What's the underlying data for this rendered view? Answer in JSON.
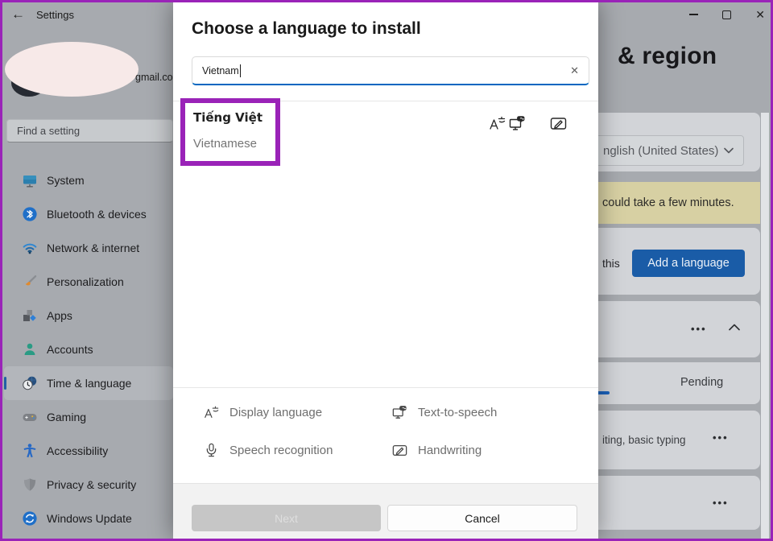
{
  "titlebar": {
    "app_title": "Settings"
  },
  "icons": {
    "back": "←",
    "close": "✕",
    "search_clear": "✕",
    "more": "•••"
  },
  "sidebar": {
    "email_fragment": "gmail.co",
    "search_placeholder": "Find a setting",
    "items": [
      {
        "label": "System",
        "icon": "system-monitor-icon"
      },
      {
        "label": "Bluetooth & devices",
        "icon": "bluetooth-icon"
      },
      {
        "label": "Network & internet",
        "icon": "wifi-icon"
      },
      {
        "label": "Personalization",
        "icon": "brush-icon"
      },
      {
        "label": "Apps",
        "icon": "apps-icon"
      },
      {
        "label": "Accounts",
        "icon": "person-icon"
      },
      {
        "label": "Time & language",
        "icon": "clock-globe-icon",
        "selected": true
      },
      {
        "label": "Gaming",
        "icon": "gamepad-icon"
      },
      {
        "label": "Accessibility",
        "icon": "accessibility-icon"
      },
      {
        "label": "Privacy & security",
        "icon": "shield-icon"
      },
      {
        "label": "Windows Update",
        "icon": "windows-update-icon"
      }
    ]
  },
  "dialog": {
    "title": "Choose a language to install",
    "search_value": "Vietnam",
    "result": {
      "native_name": "Tiếng Việt",
      "english_name": "Vietnamese",
      "capability_icons": [
        "display-language-icon",
        "text-to-speech-icon",
        "handwriting-icon"
      ]
    },
    "legend": [
      {
        "label": "Display language",
        "icon": "display-language-icon"
      },
      {
        "label": "Text-to-speech",
        "icon": "text-to-speech-icon"
      },
      {
        "label": "Speech recognition",
        "icon": "microphone-icon"
      },
      {
        "label": "Handwriting",
        "icon": "handwriting-icon"
      }
    ],
    "next_label": "Next",
    "cancel_label": "Cancel"
  },
  "background_page": {
    "heading_fragment": "& region",
    "dropdown_value_fragment": "nglish (United States)",
    "notice_fragment": "could take a few minutes.",
    "text_fragment_this": "this",
    "add_language_label": "Add a language",
    "status_pending": "Pending",
    "typing_fragment": "iting, basic typing"
  },
  "colors": {
    "accent_blue": "#0067c0",
    "button_blue": "#1a5ca7",
    "annotation_purple": "#9a23b8",
    "banner_yellow": "#d7d0a3"
  }
}
